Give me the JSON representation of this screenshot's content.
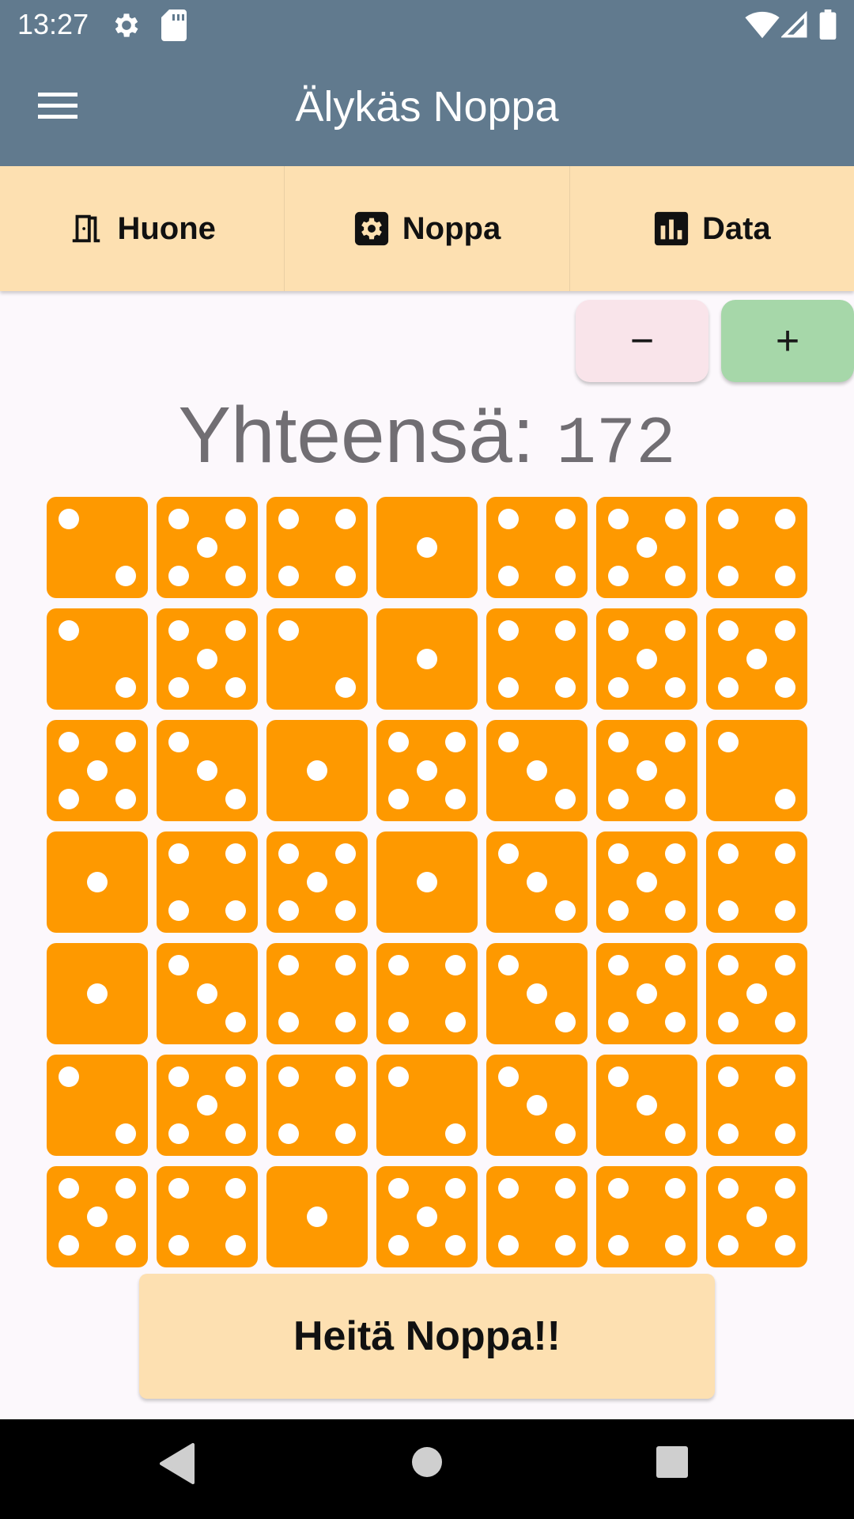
{
  "status_bar": {
    "time": "13:27",
    "icons": [
      "gear-icon",
      "sd-card-icon",
      "wifi-icon",
      "signal-icon",
      "battery-icon"
    ]
  },
  "app_bar": {
    "title": "Älykäs Noppa",
    "menu_icon": "hamburger-menu-icon"
  },
  "tabs": [
    {
      "label": "Huone",
      "icon": "door-icon"
    },
    {
      "label": "Noppa",
      "icon": "dice-gear-icon"
    },
    {
      "label": "Data",
      "icon": "bar-chart-icon"
    }
  ],
  "controls": {
    "minus_label": "−",
    "plus_label": "+"
  },
  "total": {
    "label": "Yhteensä:",
    "value": "172"
  },
  "dice": [
    2,
    5,
    4,
    1,
    4,
    5,
    4,
    2,
    5,
    2,
    1,
    4,
    5,
    5,
    5,
    3,
    1,
    5,
    3,
    5,
    2,
    1,
    4,
    5,
    1,
    3,
    5,
    4,
    1,
    3,
    4,
    4,
    3,
    5,
    5,
    2,
    5,
    4,
    2,
    3,
    3,
    4,
    5,
    4,
    1,
    5,
    4,
    4,
    5
  ],
  "roll_button": {
    "label": "Heitä Noppa!!"
  },
  "colors": {
    "app_bar": "#617a8e",
    "tab_bar": "#fde0b1",
    "die": "#fe9900",
    "minus_button": "#f9e4ea",
    "plus_button": "#a6d7a9",
    "background": "#fcf8fc"
  },
  "nav_bar": {
    "icons": [
      "back-triangle-icon",
      "home-circle-icon",
      "recents-square-icon"
    ]
  }
}
